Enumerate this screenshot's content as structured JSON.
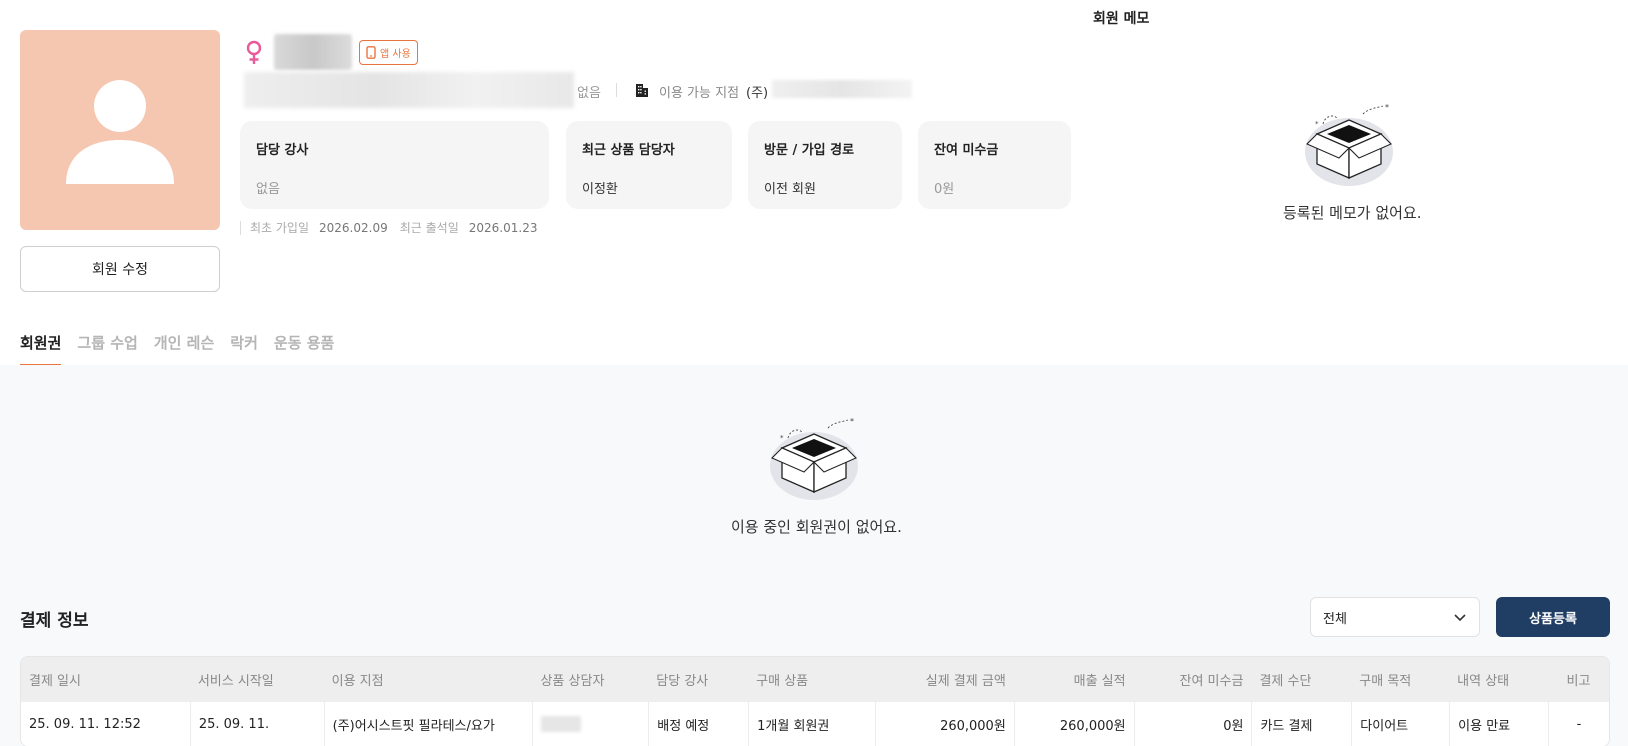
{
  "profile": {
    "edit_button": "회원 수정",
    "app_badge": "앱 사용",
    "contact_none": "없음",
    "branch_label": "이용 가능 지점",
    "branch_prefix": "(주)",
    "colors": {
      "avatar_bg": "#f6c7b0",
      "female_icon": "#e95a9a",
      "accent": "#e8753f"
    }
  },
  "cards": [
    {
      "title": "담당 강사",
      "value": "없음",
      "muted": true
    },
    {
      "title": "최근 상품 담당자",
      "value": "이정환",
      "muted": false
    },
    {
      "title": "방문 / 가입 경로",
      "value": "이전 회원",
      "muted": false
    },
    {
      "title": "잔여 미수금",
      "value": "0원",
      "muted": true
    }
  ],
  "dates": {
    "first_join_label": "최초 가입일",
    "first_join": "2026.02.09",
    "last_visit_label": "최근 출석일",
    "last_visit": "2026.01.23"
  },
  "memo": {
    "title": "회원 메모",
    "empty": "등록된 메모가 없어요."
  },
  "tabs": [
    {
      "label": "회원권",
      "active": true
    },
    {
      "label": "그룹 수업",
      "active": false
    },
    {
      "label": "개인 레슨",
      "active": false
    },
    {
      "label": "락커",
      "active": false
    },
    {
      "label": "운동 용품",
      "active": false
    }
  ],
  "membership": {
    "empty": "이용 중인 회원권이 없어요."
  },
  "payment": {
    "title": "결제 정보",
    "filter_value": "전체",
    "register_button": "상품등록",
    "columns": [
      "결제 일시",
      "서비스 시작일",
      "이용 지점",
      "상품 상담자",
      "담당 강사",
      "구매 상품",
      "실제 결제 금액",
      "매출 실적",
      "잔여 미수금",
      "결제 수단",
      "구매 목적",
      "내역 상태",
      "비고"
    ],
    "rows": [
      [
        "25. 09. 11. 12:52",
        "25. 09. 11.",
        "(주)어시스트핏 필라테스/요가",
        "",
        "배정 예정",
        "1개월 회원권",
        "260,000원",
        "260,000원",
        "0원",
        "카드 결제",
        "다이어트",
        "이용 만료",
        "-"
      ]
    ],
    "header_bg": "#eeeeee",
    "button_color": "#203e64"
  }
}
